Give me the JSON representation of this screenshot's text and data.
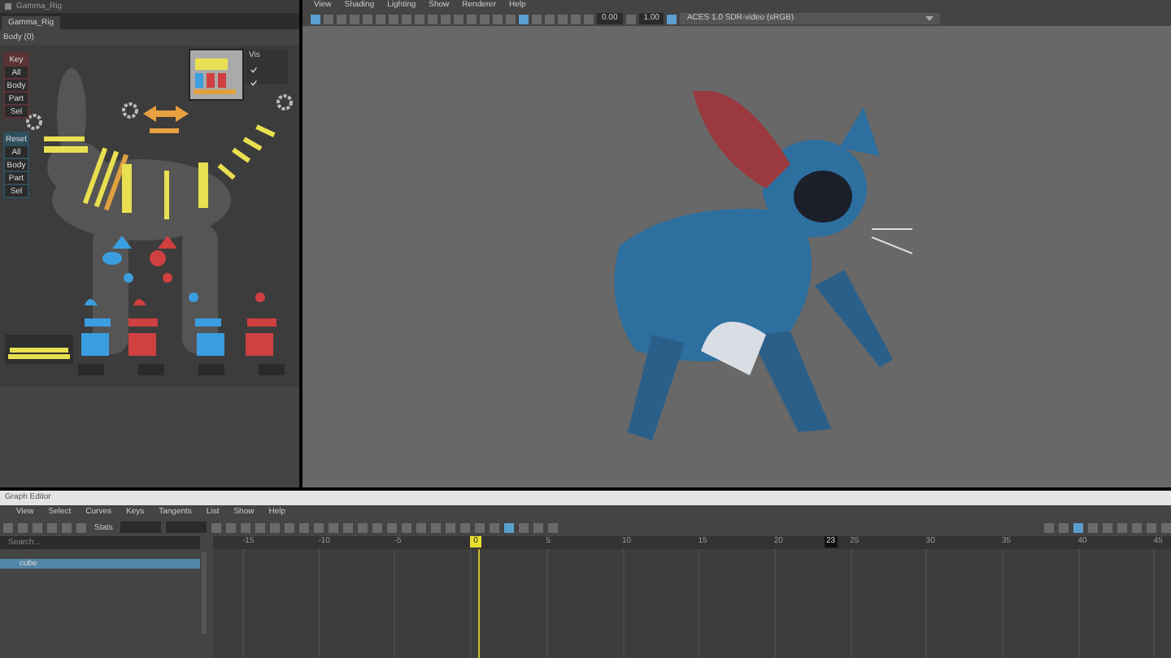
{
  "rig_window": {
    "title": "Gamma_Rig",
    "tab": "Gamma_Rig",
    "body_label": "Body (0)",
    "key_buttons": [
      {
        "label": "Key",
        "kind": "header"
      },
      {
        "label": "All",
        "kind": "button"
      },
      {
        "label": "Body",
        "kind": "button"
      },
      {
        "label": "Part",
        "kind": "button"
      },
      {
        "label": "Sel",
        "kind": "button"
      }
    ],
    "reset_buttons": [
      {
        "label": "Reset",
        "kind": "header"
      },
      {
        "label": "All",
        "kind": "button"
      },
      {
        "label": "Body",
        "kind": "button"
      },
      {
        "label": "Part",
        "kind": "button"
      },
      {
        "label": "Sel",
        "kind": "button"
      }
    ],
    "vis_panel": {
      "title": "Vis",
      "checkboxes": [
        {
          "checked": true
        },
        {
          "checked": true
        }
      ]
    }
  },
  "viewport": {
    "menu": [
      "View",
      "Shading",
      "Lighting",
      "Show",
      "Renderer",
      "Help"
    ],
    "fields": [
      "0.00",
      "1.00"
    ],
    "color_space": "ACES 1.0 SDR-video (sRGB)"
  },
  "graph_editor": {
    "title": "Graph Editor",
    "menu": [
      "View",
      "Select",
      "Curves",
      "Keys",
      "Tangents",
      "List",
      "Show",
      "Help"
    ],
    "stats_label": "Stats",
    "search": {
      "placeholder": "Search..."
    },
    "outliner": [
      {
        "label": "cube",
        "selected": true
      }
    ],
    "ruler": [
      {
        "label": "-15",
        "kind": "tick"
      },
      {
        "label": "-10",
        "kind": "tick"
      },
      {
        "label": "-5",
        "kind": "tick"
      },
      {
        "label": "0",
        "kind": "current"
      },
      {
        "label": "5",
        "kind": "tick"
      },
      {
        "label": "10",
        "kind": "tick"
      },
      {
        "label": "15",
        "kind": "tick"
      },
      {
        "label": "20",
        "kind": "tick"
      },
      {
        "label": "25",
        "kind": "tick"
      },
      {
        "label": "30",
        "kind": "tick"
      },
      {
        "label": "35",
        "kind": "tick"
      },
      {
        "label": "40",
        "kind": "tick"
      },
      {
        "label": "45",
        "kind": "tick"
      }
    ],
    "end_marker": "23"
  }
}
